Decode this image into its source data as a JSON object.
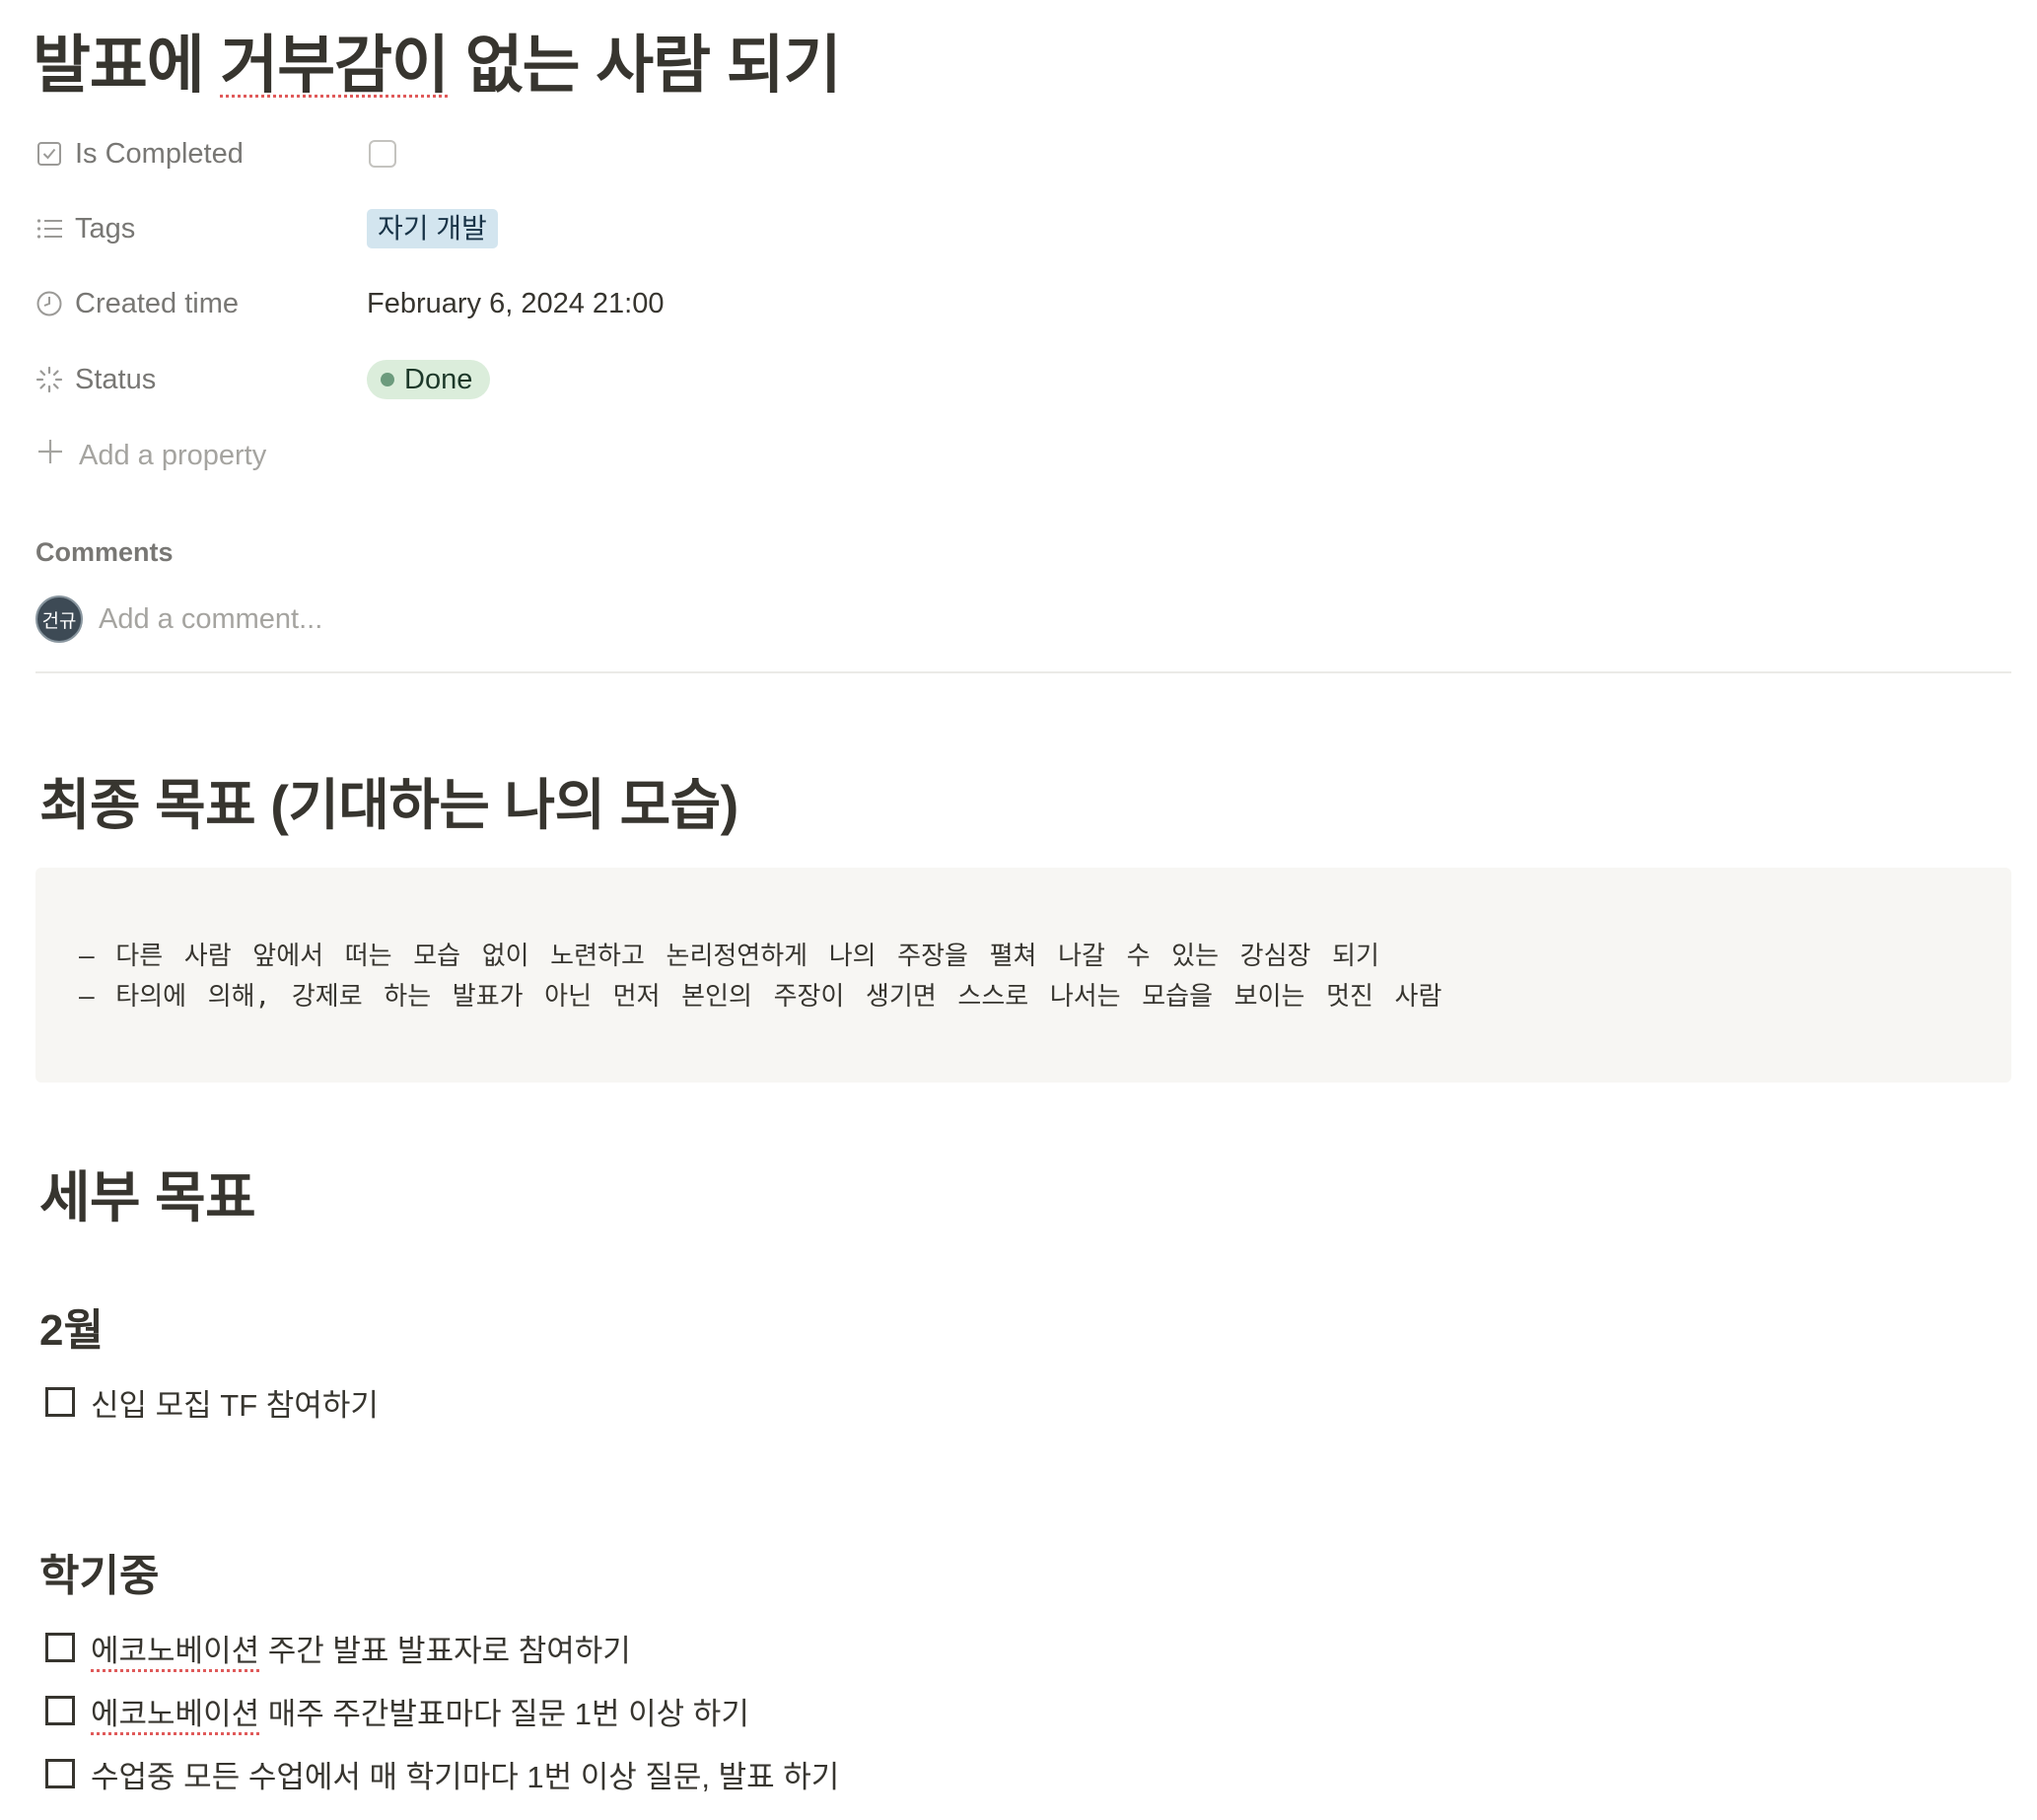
{
  "page": {
    "title_prefix": "발표에 ",
    "title_underlined": "거부감이",
    "title_suffix": " 없는 사람 되기"
  },
  "properties": {
    "is_completed": {
      "label": "Is Completed",
      "checked": false
    },
    "tags": {
      "label": "Tags",
      "values": [
        "자기 개발"
      ],
      "color": "#d3e5ef"
    },
    "created_time": {
      "label": "Created time",
      "value": "February 6, 2024 21:00"
    },
    "status": {
      "label": "Status",
      "value": "Done",
      "color": "#dbeddb",
      "dot_color": "#6c9b7d"
    },
    "add_property_label": "Add a property"
  },
  "comments": {
    "heading": "Comments",
    "avatar_initials": "건규",
    "placeholder": "Add a comment..."
  },
  "content": {
    "final_goal": {
      "heading": "최종 목표 (기대하는 나의 모습)",
      "code_lines": [
        "– 다른 사람 앞에서 떠는 모습 없이 노련하고 논리정연하게 나의 주장을 펼쳐 나갈 수 있는 강심장 되기",
        "– 타의에 의해, 강제로 하는 발표가 아닌 먼저 본인의 주장이 생기면 스스로 나서는 모습을 보이는 멋진 사람"
      ]
    },
    "detail_goals": {
      "heading": "세부 목표",
      "february": {
        "heading": "2월",
        "todos": [
          {
            "text": "신입 모집 TF 참여하기",
            "checked": false
          }
        ]
      },
      "semester": {
        "heading": "학기중",
        "todos": [
          {
            "underlined": "에코노베이션",
            "text": " 주간 발표 발표자로 참여하기",
            "checked": false
          },
          {
            "underlined": "에코노베이션",
            "text": " 매주 주간발표마다 질문 1번 이상 하기",
            "checked": false
          },
          {
            "underlined": "",
            "text": "수업중 모든 수업에서 매 학기마다 1번 이상 질문, 발표 하기",
            "checked": false
          }
        ]
      }
    }
  }
}
